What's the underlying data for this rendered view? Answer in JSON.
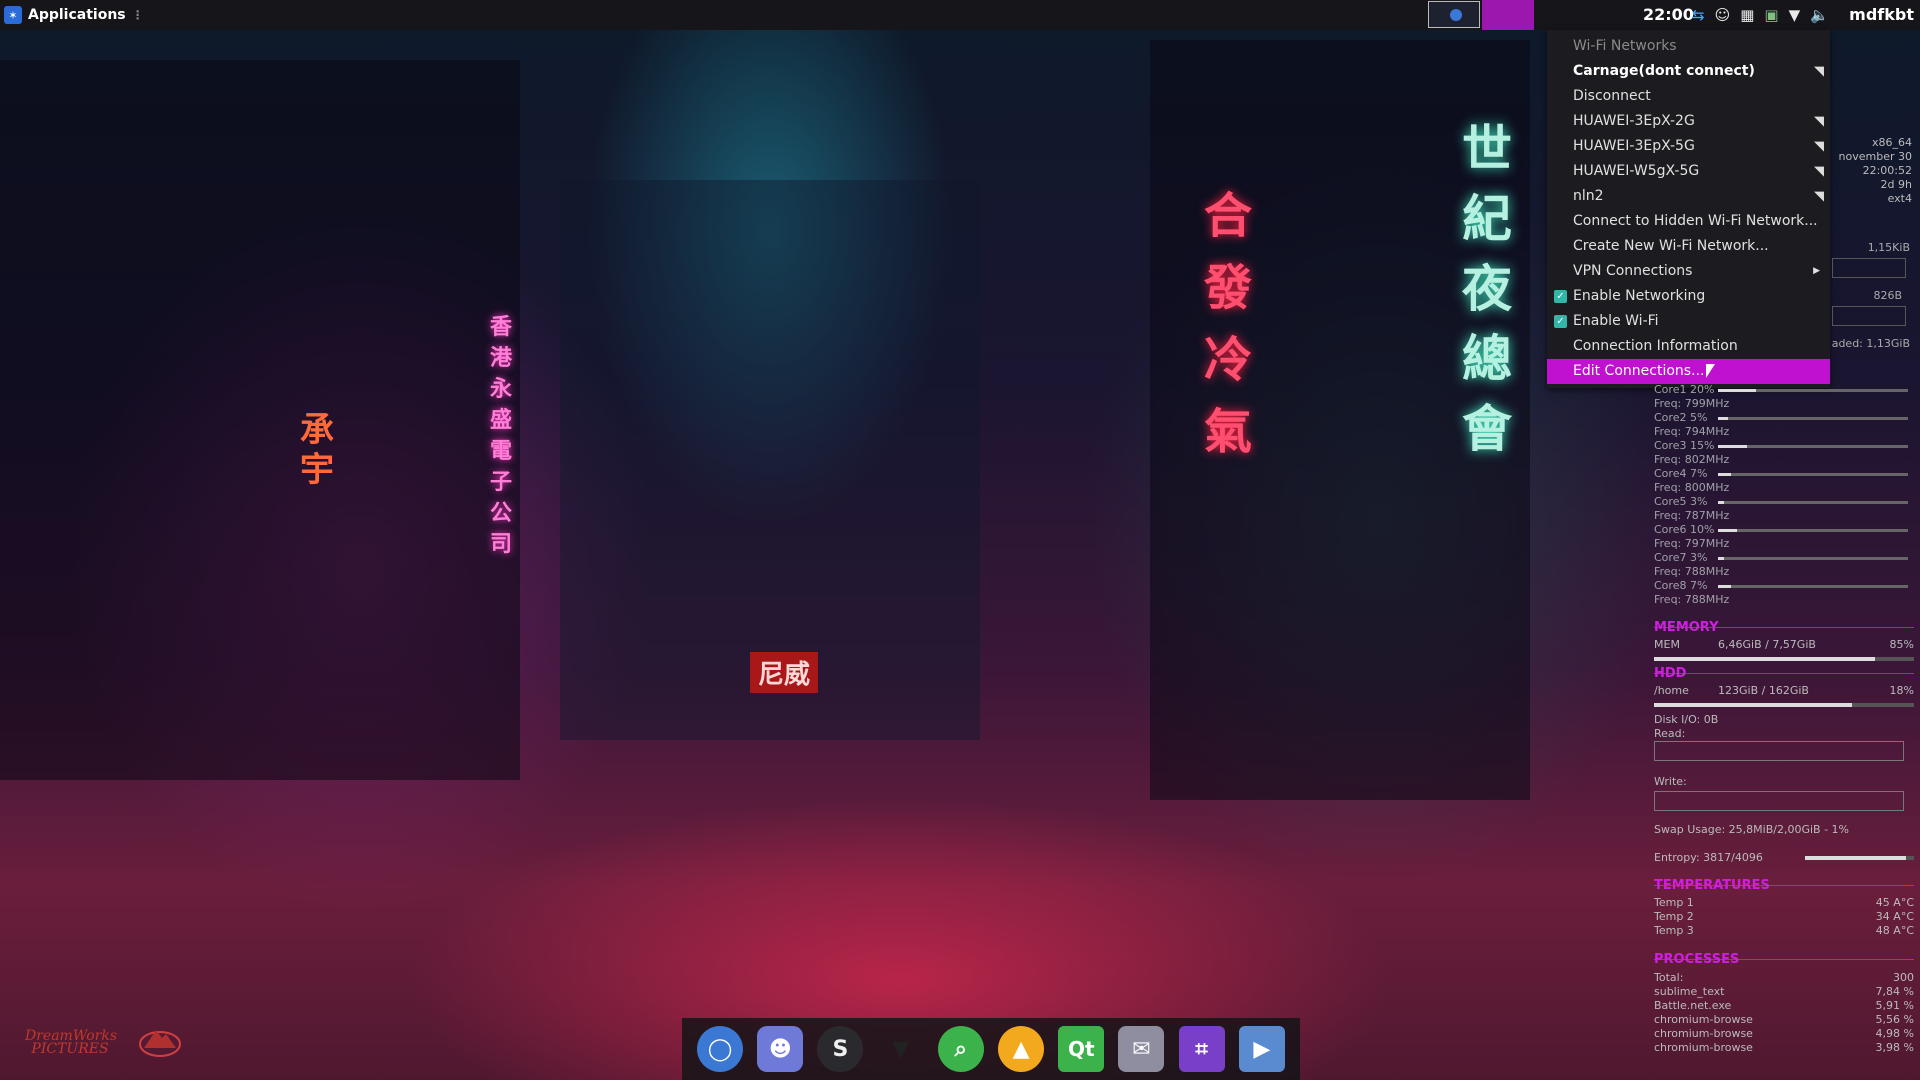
{
  "panel": {
    "apps_label": "Applications",
    "clock": "22:00",
    "user": "mdfkbt",
    "tray_icons": [
      "teamviewer-icon",
      "discord-icon",
      "window-icon",
      "image-viewer-icon",
      "wifi-icon",
      "volume-icon"
    ]
  },
  "menu": {
    "header": "Wi-Fi Networks",
    "active_network": "Carnage(dont connect)",
    "disconnect": "Disconnect",
    "networks": [
      "HUAWEI-3EpX-2G",
      "HUAWEI-3EpX-5G",
      "HUAWEI-W5gX-5G",
      "nln2"
    ],
    "connect_hidden": "Connect to Hidden Wi-Fi Network...",
    "create_new": "Create New Wi-Fi Network...",
    "vpn": "VPN Connections",
    "enable_networking": "Enable Networking",
    "enable_wifi": "Enable Wi-Fi",
    "connection_info": "Connection Information",
    "edit_connections": "Edit Connections..."
  },
  "conky": {
    "sysinfo": [
      "x86_64",
      "november 30",
      "22:00:52",
      "2d 9h",
      "ext4"
    ],
    "net_up": "1,15KiB",
    "net_down": "826B",
    "net_total": "aded: 1,13GiB",
    "cores": [
      {
        "label": "Core1 20%",
        "pct": 20,
        "freq": "Freq: 799MHz"
      },
      {
        "label": "Core2 5%",
        "pct": 5,
        "freq": "Freq: 794MHz"
      },
      {
        "label": "Core3 15%",
        "pct": 15,
        "freq": "Freq: 802MHz"
      },
      {
        "label": "Core4 7%",
        "pct": 7,
        "freq": "Freq: 800MHz"
      },
      {
        "label": "Core5 3%",
        "pct": 3,
        "freq": "Freq: 787MHz"
      },
      {
        "label": "Core6 10%",
        "pct": 10,
        "freq": "Freq: 797MHz"
      },
      {
        "label": "Core7 3%",
        "pct": 3,
        "freq": "Freq: 788MHz"
      },
      {
        "label": "Core8 7%",
        "pct": 7,
        "freq": "Freq: 788MHz"
      }
    ],
    "memory_title": "MEMORY",
    "mem_label": "MEM",
    "mem_value": "6,46GiB / 7,57GiB",
    "mem_pct": "85%",
    "mem_fraction": 0.85,
    "hdd_title": "HDD",
    "home_label": "/home",
    "home_value": "123GiB  / 162GiB",
    "home_pct": "18%",
    "home_fraction": 0.76,
    "disk_io": "Disk I/O: 0B",
    "read": "Read:",
    "write": "Write:",
    "swap": "Swap Usage: 25,8MiB/2,00GiB - 1%",
    "entropy": "Entropy: 3817/4096",
    "temps_title": "TEMPERATURES",
    "temps": [
      {
        "label": "Temp 1",
        "value": "45 A°C"
      },
      {
        "label": "Temp 2",
        "value": "34 A°C"
      },
      {
        "label": "Temp 3",
        "value": "48 A°C"
      }
    ],
    "proc_title": "PROCESSES",
    "procs": [
      {
        "label": "Total:",
        "value": "300"
      },
      {
        "label": "sublime_text",
        "value": "7,84 %"
      },
      {
        "label": "Battle.net.exe",
        "value": "5,91 %"
      },
      {
        "label": "chromium-browse",
        "value": "5,56 %"
      },
      {
        "label": "chromium-browse",
        "value": "4,98 %"
      },
      {
        "label": "chromium-browse",
        "value": "3,98 %"
      }
    ]
  },
  "wallpaper": {
    "sign_left": "香港永盛電子公司",
    "sign_right": "合發冷氣",
    "sign_far_right": "世紀夜總會",
    "sign_store": "承宇",
    "sign_restaurant": "尼威"
  },
  "logos": {
    "dreamworks": "DreamWorks PICTURES"
  },
  "dock": [
    "chromium-icon",
    "discord-icon",
    "skype-icon",
    "inkscape-icon",
    "search-icon",
    "vlc-icon",
    "qt-icon",
    "pidgin-icon",
    "crop-icon",
    "screencast-icon"
  ]
}
